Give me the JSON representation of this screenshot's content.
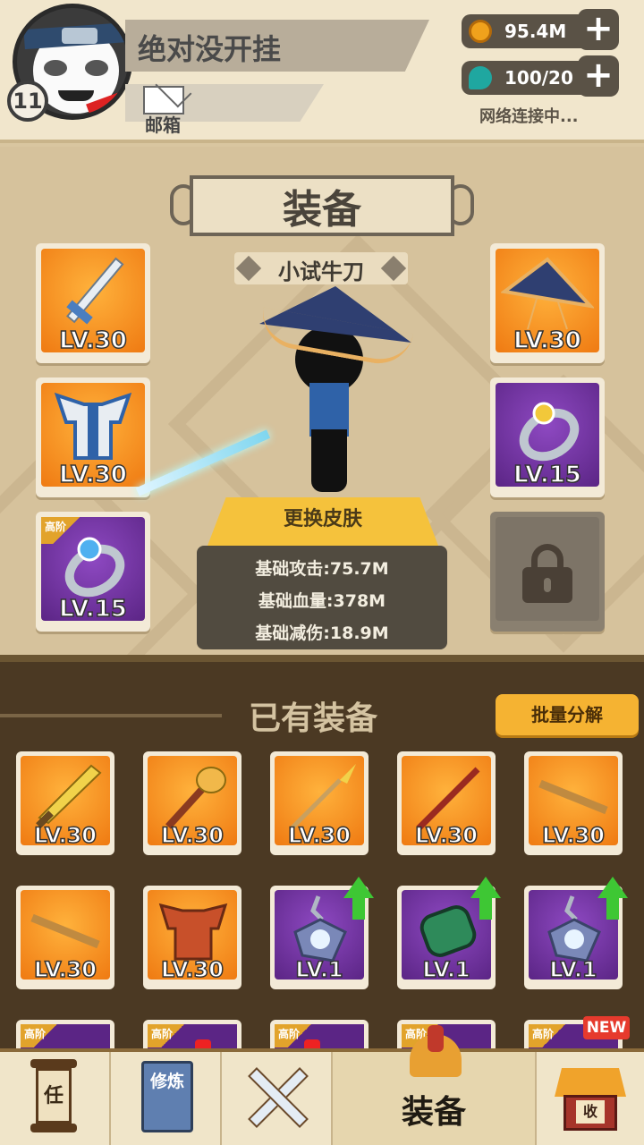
{
  "header": {
    "player_name": "绝对没开挂",
    "level": "11",
    "mail_label": "邮箱",
    "resources": [
      {
        "name": "coin",
        "value": "95.4M",
        "icon": "coin-icon",
        "color": "#f0a21c"
      },
      {
        "name": "gem",
        "value": "100/20",
        "icon": "teal-drop-icon",
        "color": "#1fa7a0"
      }
    ],
    "network_status": "网络连接中..."
  },
  "equip_panel": {
    "title": "装备",
    "character_name": "小试牛刀",
    "slots": [
      {
        "icon": "sword-icon",
        "level": "LV.30",
        "rarity": "orange"
      },
      {
        "icon": "armor-icon",
        "level": "LV.30",
        "rarity": "orange"
      },
      {
        "icon": "ring-icon",
        "level": "LV.15",
        "rarity": "purple",
        "tag": "高阶"
      },
      {
        "icon": "straw-hat-icon",
        "level": "LV.30",
        "rarity": "orange"
      },
      {
        "icon": "ring-icon",
        "level": "LV.15",
        "rarity": "purple"
      },
      {
        "icon": "lock-icon",
        "locked": true
      }
    ],
    "change_skin_label": "更换皮肤",
    "stats": [
      "基础攻击:75.7M",
      "基础血量:378M",
      "基础减伤:18.9M"
    ]
  },
  "inventory": {
    "title": "已有装备",
    "batch_button": "批量分解",
    "items": [
      {
        "icon": "broadsword-icon",
        "level": "LV.30",
        "rarity": "orange"
      },
      {
        "icon": "mace-icon",
        "level": "LV.30",
        "rarity": "orange"
      },
      {
        "icon": "spear-icon",
        "level": "LV.30",
        "rarity": "orange"
      },
      {
        "icon": "staff-icon",
        "level": "LV.30",
        "rarity": "orange"
      },
      {
        "icon": "flute-icon",
        "level": "LV.30",
        "rarity": "orange"
      },
      {
        "icon": "flute-icon",
        "level": "LV.30",
        "rarity": "orange"
      },
      {
        "icon": "red-armor-icon",
        "level": "LV.30",
        "rarity": "orange"
      },
      {
        "icon": "amulet-icon",
        "level": "LV.1",
        "rarity": "purple",
        "upgrade": true
      },
      {
        "icon": "green-bracer-icon",
        "level": "LV.1",
        "rarity": "purple",
        "upgrade": true
      },
      {
        "icon": "amulet-icon",
        "level": "LV.1",
        "rarity": "purple",
        "upgrade": true
      }
    ],
    "partial_row_tags": [
      "高阶",
      "高阶",
      "高阶",
      "高阶",
      "高阶"
    ],
    "new_badge": "NEW"
  },
  "bottom_nav": {
    "items": [
      {
        "id": "task",
        "icon": "scroll-icon",
        "glyph": "任"
      },
      {
        "id": "train",
        "icon": "book-icon",
        "glyph": "修炼"
      },
      {
        "id": "battle",
        "icon": "crossed-swords-icon"
      },
      {
        "id": "equip",
        "icon": "helmet-icon",
        "label": "装备",
        "active": true
      },
      {
        "id": "shop",
        "icon": "shop-icon",
        "glyph": "收"
      }
    ]
  }
}
